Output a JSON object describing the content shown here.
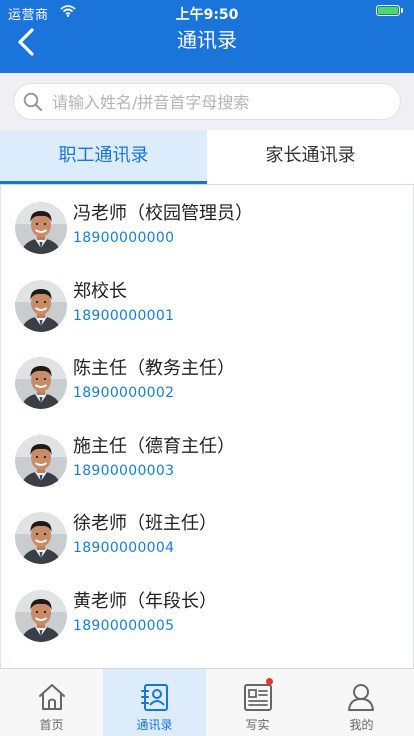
{
  "status_bar": {
    "carrier": "运营商",
    "time": "上午9:50"
  },
  "nav": {
    "title": "通讯录"
  },
  "search": {
    "placeholder": "请输入姓名/拼音首字母搜索",
    "value": ""
  },
  "tabs": [
    {
      "label": "职工通讯录",
      "active": true
    },
    {
      "label": "家长通讯录",
      "active": false
    }
  ],
  "contacts": [
    {
      "name": "冯老师（校园管理员）",
      "phone": "18900000000"
    },
    {
      "name": "郑校长",
      "phone": "18900000001"
    },
    {
      "name": "陈主任（教务主任）",
      "phone": "18900000002"
    },
    {
      "name": "施主任（德育主任）",
      "phone": "18900000003"
    },
    {
      "name": "徐老师（班主任）",
      "phone": "18900000004"
    },
    {
      "name": "黄老师（年段长）",
      "phone": "18900000005"
    }
  ],
  "tab_bar": [
    {
      "label": "首页",
      "icon": "home-icon",
      "active": false
    },
    {
      "label": "通讯录",
      "icon": "contacts-icon",
      "active": true
    },
    {
      "label": "写实",
      "icon": "record-icon",
      "active": false,
      "badge": true
    },
    {
      "label": "我的",
      "icon": "profile-icon",
      "active": false
    }
  ],
  "colors": {
    "primary": "#1a74d9",
    "active_tab_bg": "#dcecfb",
    "phone_text": "#1a7fd4",
    "badge": "#e8392c",
    "battery": "#4cd964"
  }
}
